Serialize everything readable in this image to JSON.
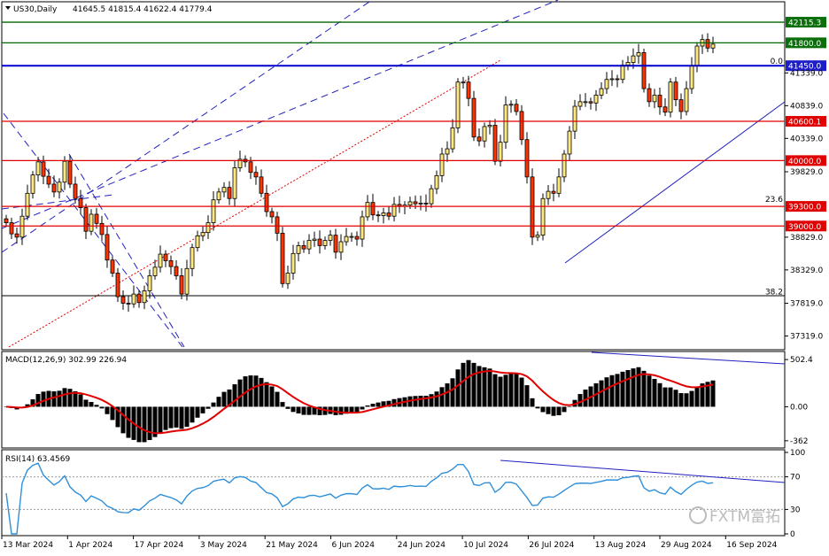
{
  "header": {
    "symbol": "US30,Daily",
    "ohlc": "41645.5 41815.4 41622.4 41779.4"
  },
  "colors": {
    "bull": "#ffe97f",
    "bear": "#ff3300",
    "outline": "#000000",
    "signal": "#e00000",
    "rsi_line": "#2f8fd8",
    "channel": "#2020c0",
    "hline_red": "#e00000",
    "hline_green": "#006600",
    "hline_blue": "#0000cc"
  },
  "price_axis": {
    "ticks": [
      "41339.0",
      "40839.0",
      "40339.0",
      "39829.0",
      "38829.0",
      "38329.0",
      "37819.0",
      "37319.0"
    ],
    "min": 37150,
    "max": 42400
  },
  "levels": [
    {
      "label": "42115.3",
      "value": 42115.3,
      "kind": "green"
    },
    {
      "label": "41800.0",
      "value": 41800.0,
      "kind": "green"
    },
    {
      "label": "41450.0",
      "value": 41450.0,
      "kind": "blue"
    },
    {
      "label": "40600.1",
      "value": 40600.1,
      "kind": "red"
    },
    {
      "label": "40000.0",
      "value": 40000.0,
      "kind": "red"
    },
    {
      "label": "39300.0",
      "value": 39300.0,
      "kind": "red"
    },
    {
      "label": "39000.0",
      "value": 39000.0,
      "kind": "red"
    }
  ],
  "fib_labels": [
    {
      "text": "0.0",
      "value": 41450
    },
    {
      "text": "23.6",
      "value": 39345
    },
    {
      "text": "38.2",
      "value": 37930
    }
  ],
  "macd": {
    "label": "MACD(12,26,9) 302.99 226.94",
    "ticks": [
      "502.4",
      "0.00",
      "-362"
    ],
    "min": -420,
    "max": 560
  },
  "rsi": {
    "label": "RSI(14) 63.4569",
    "ticks": [
      "100",
      "70",
      "30",
      "0"
    ],
    "min": 0,
    "max": 100
  },
  "x_axis": {
    "dates": [
      "13 Mar 2024",
      "1 Apr 2024",
      "17 Apr 2024",
      "3 May 2024",
      "21 May 2024",
      "6 Jun 2024",
      "24 Jun 2024",
      "10 Jul 2024",
      "26 Jul 2024",
      "13 Aug 2024",
      "29 Aug 2024",
      "16 Sep 2024"
    ]
  },
  "watermark": "FXTM富拓",
  "chart_data": {
    "type": "candlestick",
    "title": "US30,Daily",
    "ylim": [
      37150,
      42400
    ],
    "closes": [
      39050,
      38880,
      38830,
      39150,
      39500,
      39780,
      39980,
      39760,
      39640,
      39520,
      39670,
      39990,
      39640,
      39420,
      39280,
      38920,
      39180,
      39040,
      38870,
      38480,
      38280,
      37920,
      37820,
      37810,
      37960,
      37830,
      38010,
      38240,
      38370,
      38570,
      38470,
      38380,
      38240,
      37960,
      38350,
      38670,
      38850,
      38900,
      39050,
      39400,
      39520,
      39590,
      39420,
      39890,
      40020,
      39980,
      39820,
      39750,
      39500,
      39220,
      39140,
      38890,
      38120,
      38280,
      38580,
      38700,
      38650,
      38780,
      38800,
      38700,
      38780,
      38860,
      38600,
      38760,
      38840,
      38840,
      38800,
      39140,
      39360,
      39170,
      39160,
      39200,
      39150,
      39330,
      39300,
      39320,
      39370,
      39340,
      39350,
      39340,
      39570,
      39770,
      40100,
      40180,
      40500,
      41200,
      41200,
      40950,
      40360,
      40300,
      40520,
      40540,
      39990,
      40280,
      40850,
      40860,
      40750,
      40320,
      39750,
      38830,
      38860,
      39420,
      39530,
      39500,
      39750,
      40100,
      40450,
      40830,
      40900,
      40900,
      40880,
      41000,
      41100,
      41240,
      41250,
      41240,
      41460,
      41500,
      41600,
      41650,
      41100,
      40900,
      41000,
      40820,
      40740,
      41200,
      40930,
      40750,
      41100,
      41450,
      41750,
      41850,
      41720,
      41779
    ]
  }
}
